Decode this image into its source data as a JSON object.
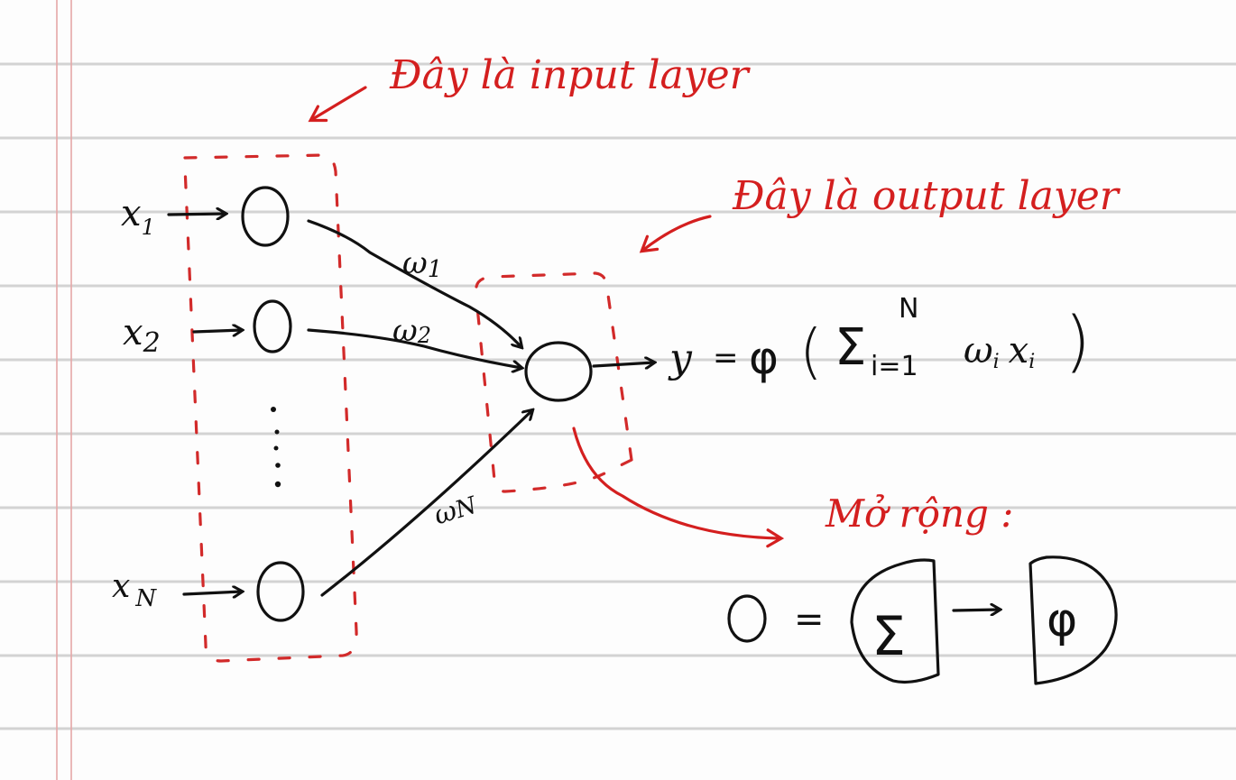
{
  "annotations": {
    "input_layer_label": "Đây là input layer",
    "output_layer_label": "Đây là output layer",
    "expand_label": "Mở rộng :"
  },
  "inputs": [
    {
      "name": "x",
      "sub": "1"
    },
    {
      "name": "x",
      "sub": "2"
    },
    {
      "name": "x",
      "sub": "N"
    }
  ],
  "ellipsis": "⋮",
  "weights": [
    {
      "name": "ω",
      "sub": "1"
    },
    {
      "name": "ω",
      "sub": "2"
    },
    {
      "name": "ω",
      "sub": "N"
    }
  ],
  "formula": {
    "lhs": "y",
    "equals": "=",
    "activation": "φ",
    "open_paren": "(",
    "sigma": "Σ",
    "upper_limit": "N",
    "lower_limit": "i=1",
    "term_weight": "ω",
    "term_weight_sub": "i",
    "term_input": "x",
    "term_input_sub": "i",
    "close_paren": ")"
  },
  "expansion": {
    "neuron_symbol": "O",
    "equals": "=",
    "sum_symbol": "Σ",
    "arrow": "→",
    "activation_symbol": "φ"
  },
  "colors": {
    "ink": "#111111",
    "annotation": "#d41f1f",
    "layer_box": "#d22a2a",
    "ruled_line": "#d3d3d3",
    "margin_line": "#e6a7a7",
    "paper": "#fdfdfd"
  }
}
